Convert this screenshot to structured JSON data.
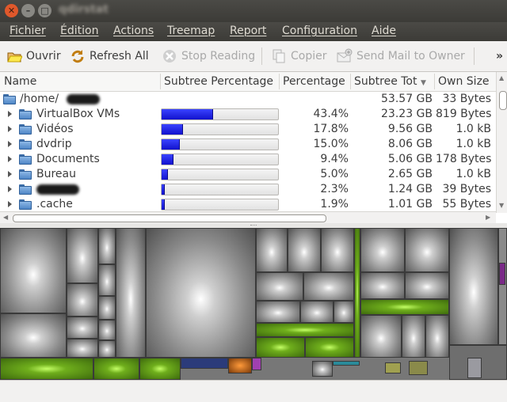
{
  "window": {
    "title": "qdirstat"
  },
  "menu": [
    "Fichier",
    "Édition",
    "Actions",
    "Treemap",
    "Report",
    "Configuration",
    "Aide"
  ],
  "toolbar": {
    "open": "Ouvrir",
    "refresh_all": "Refresh All",
    "stop_reading": "Stop Reading",
    "copy": "Copier",
    "send_mail": "Send Mail to Owner",
    "more": "»"
  },
  "columns": [
    "Name",
    "Subtree Percentage",
    "Percentage",
    "Subtree Tot",
    "Own Size"
  ],
  "root": {
    "name": "/home/",
    "subtree_total": "53.57 GB",
    "own_size": "33 Bytes"
  },
  "rows": [
    {
      "name": "VirtualBox VMs",
      "percentage": "43.4%",
      "subtree_total": "23.23 GB",
      "own_size": "819 Bytes",
      "fraction": 0.434
    },
    {
      "name": "Vidéos",
      "percentage": "17.8%",
      "subtree_total": "9.56 GB",
      "own_size": "1.0 kB",
      "fraction": 0.178
    },
    {
      "name": "dvdrip",
      "percentage": "15.0%",
      "subtree_total": "8.06 GB",
      "own_size": "1.0 kB",
      "fraction": 0.15
    },
    {
      "name": "Documents",
      "percentage": "9.4%",
      "subtree_total": "5.06 GB",
      "own_size": "178 Bytes",
      "fraction": 0.094
    },
    {
      "name": "Bureau",
      "percentage": "5.0%",
      "subtree_total": "2.65 GB",
      "own_size": "1.0 kB",
      "fraction": 0.05
    },
    {
      "name": "",
      "percentage": "2.3%",
      "subtree_total": "1.24 GB",
      "own_size": "39 Bytes",
      "fraction": 0.023
    },
    {
      "name": ".cache",
      "percentage": "1.9%",
      "subtree_total": "1.01 GB",
      "own_size": "55 Bytes",
      "fraction": 0.019
    }
  ],
  "colors": {
    "bar": "#2222ee",
    "menubar": "#3c3b37",
    "accent_close": "#e0582b"
  }
}
